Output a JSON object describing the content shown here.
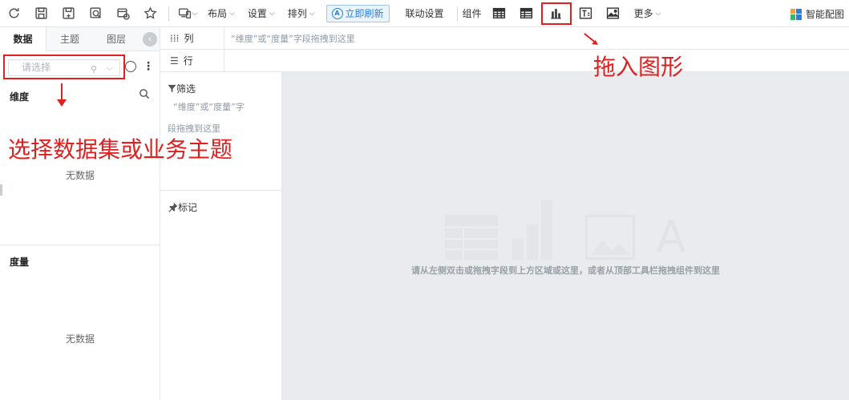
{
  "toolbar": {
    "menus": [
      {
        "label": "布局"
      },
      {
        "label": "设置"
      },
      {
        "label": "排列"
      }
    ],
    "refresh_label": "立即刷新",
    "link_settings_label": "联动设置",
    "components_label": "组件",
    "more_label": "更多",
    "smart_label": "智能配图"
  },
  "left_panel": {
    "tabs": [
      "数据",
      "主题",
      "图层"
    ],
    "select_placeholder": "请选择",
    "dimension_title": "维度",
    "dimension_empty": "无数据",
    "measure_title": "度量",
    "measure_empty": "无数据"
  },
  "shelf": {
    "columns_label": "列",
    "rows_label": "行",
    "hint": "“维度”或“度量”字段拖拽到这里"
  },
  "filter": {
    "title": "筛选",
    "hint_line1": "“维度”或“度量”字",
    "hint_line2": "段拖拽到这里",
    "mark_title": "标记"
  },
  "canvas": {
    "hint": "请从左侧双击或拖拽字段到上方区域或这里，或者从顶部工具栏拖拽组件到这里",
    "placeholder_letter": "A"
  },
  "annotations": {
    "drag_shape": "拖入图形",
    "choose_dataset": "选择数据集或业务主题"
  },
  "colors": {
    "accent": "#2c7fd6",
    "annotation": "#e02020",
    "canvas_bg": "#e9ebee"
  }
}
